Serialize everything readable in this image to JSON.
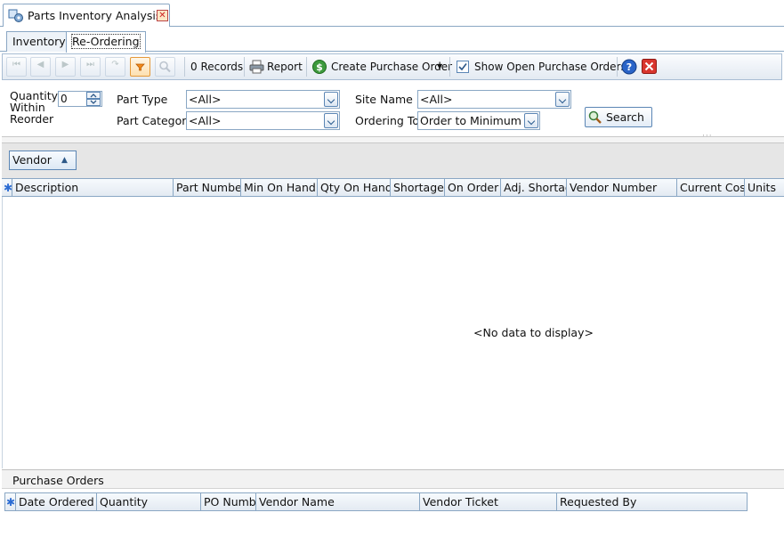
{
  "window": {
    "tab_title": "Parts Inventory Analysis"
  },
  "subtabs": [
    {
      "label": "Inventory",
      "active": false
    },
    {
      "label": "Re-Ordering",
      "active": true
    }
  ],
  "toolbar": {
    "records": "0 Records",
    "report": "Report",
    "create_po": "Create Purchase Order",
    "show_open_po": "Show Open Purchase Orders",
    "show_open_po_checked": true
  },
  "filters": {
    "quantity_label": "Quantity\nWithin\nReorder",
    "quantity_value": "0",
    "part_type_label": "Part Type",
    "part_type_value": "<All>",
    "part_category_label": "Part Category",
    "part_category_value": "<All>",
    "site_name_label": "Site Name",
    "site_name_value": "<All>",
    "ordering_to_label": "Ordering To",
    "ordering_to_value": "Order to Minimum",
    "search_label": "Search"
  },
  "grouping": {
    "chip_label": "Vendor"
  },
  "grid": {
    "columns": [
      "Description",
      "Part Number",
      "Min On Hand",
      "Qty On Hand",
      "Shortage",
      "On Order",
      "Adj. Shortage",
      "Vendor Number",
      "Current Cost",
      "Units"
    ],
    "empty_text": "<No data to display>"
  },
  "purchase_orders": {
    "title": "Purchase Orders",
    "columns": [
      "Date Ordered",
      "Quantity",
      "PO Number",
      "Vendor Name",
      "Vendor Ticket",
      "Requested By"
    ]
  }
}
